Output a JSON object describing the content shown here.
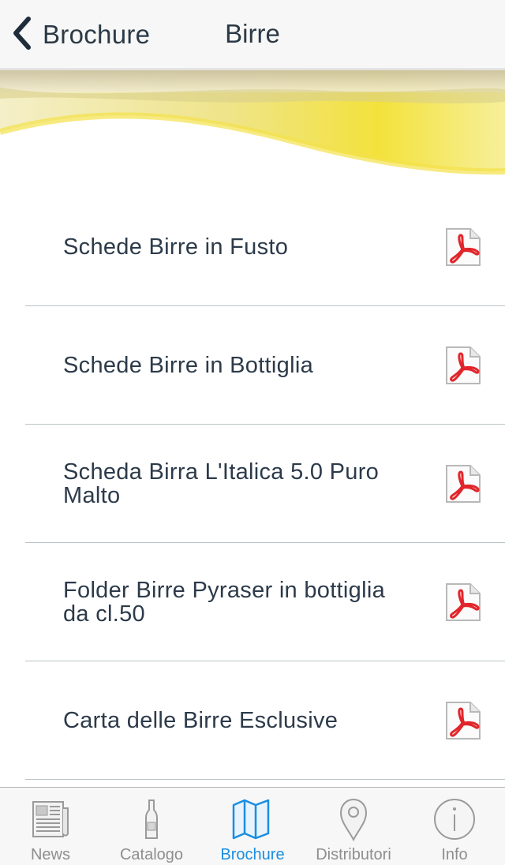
{
  "navbar": {
    "back_label": "Brochure",
    "title": "Birre"
  },
  "list": {
    "items": [
      {
        "label": "Schede Birre in Fusto",
        "icon": "pdf-icon"
      },
      {
        "label": "Schede Birre in Bottiglia",
        "icon": "pdf-icon"
      },
      {
        "label": "Scheda Birra L'Italica 5.0 Puro Malto",
        "icon": "pdf-icon"
      },
      {
        "label": "Folder Birre Pyraser in bottiglia da cl.50",
        "icon": "pdf-icon"
      },
      {
        "label": "Carta delle Birre Esclusive",
        "icon": "pdf-icon"
      }
    ]
  },
  "tabbar": {
    "tabs": [
      {
        "label": "News",
        "icon": "newspaper-icon",
        "active": false
      },
      {
        "label": "Catalogo",
        "icon": "bottle-icon",
        "active": false
      },
      {
        "label": "Brochure",
        "icon": "map-icon",
        "active": true
      },
      {
        "label": "Distributori",
        "icon": "location-pin-icon",
        "active": false
      },
      {
        "label": "Info",
        "icon": "info-icon",
        "active": false
      }
    ]
  },
  "colors": {
    "accent": "#1a8de0",
    "text": "#2c3a4a",
    "inactive_tab": "#8e8e8e",
    "pdf_red": "#e0262b",
    "banner_yellow": "#f2e04a"
  }
}
